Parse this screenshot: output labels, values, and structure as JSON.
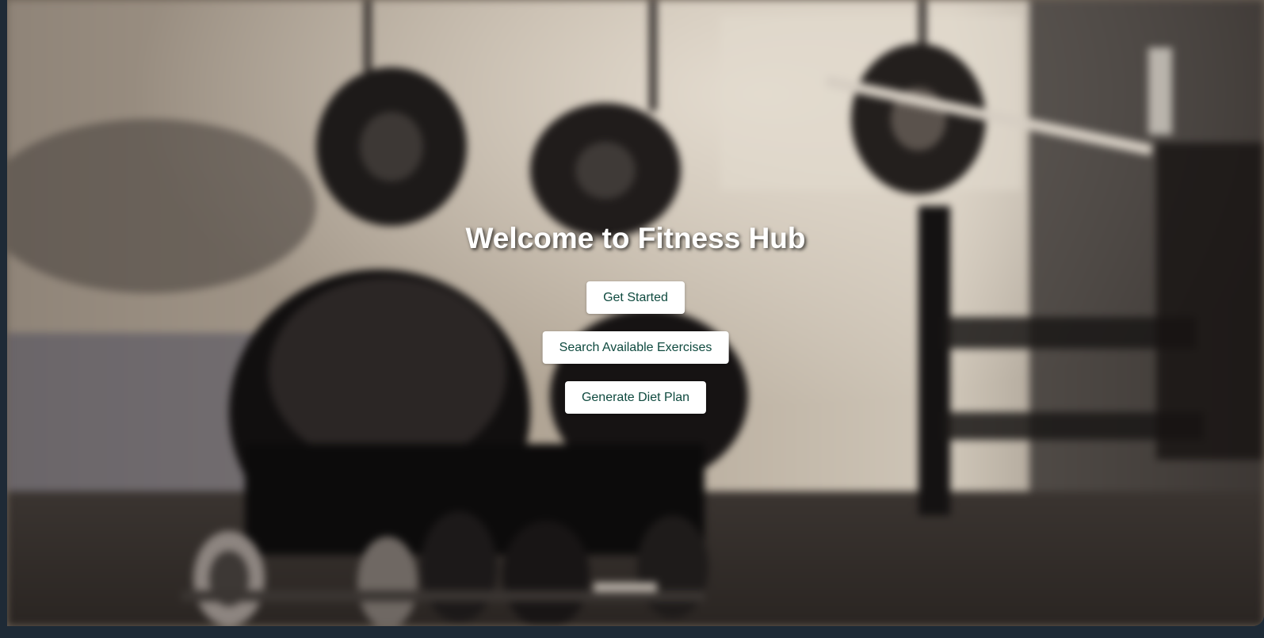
{
  "hero": {
    "title": "Welcome to Fitness Hub",
    "background_icon": "gym-weights-photo"
  },
  "actions": [
    {
      "label": "Get Started"
    },
    {
      "label": "Search Available Exercises"
    },
    {
      "label": "Generate Diet Plan"
    }
  ],
  "colors": {
    "button_bg": "#ffffff",
    "button_text": "#0f4a3f",
    "title_text": "#ffffff",
    "frame": "#1e2a36"
  }
}
